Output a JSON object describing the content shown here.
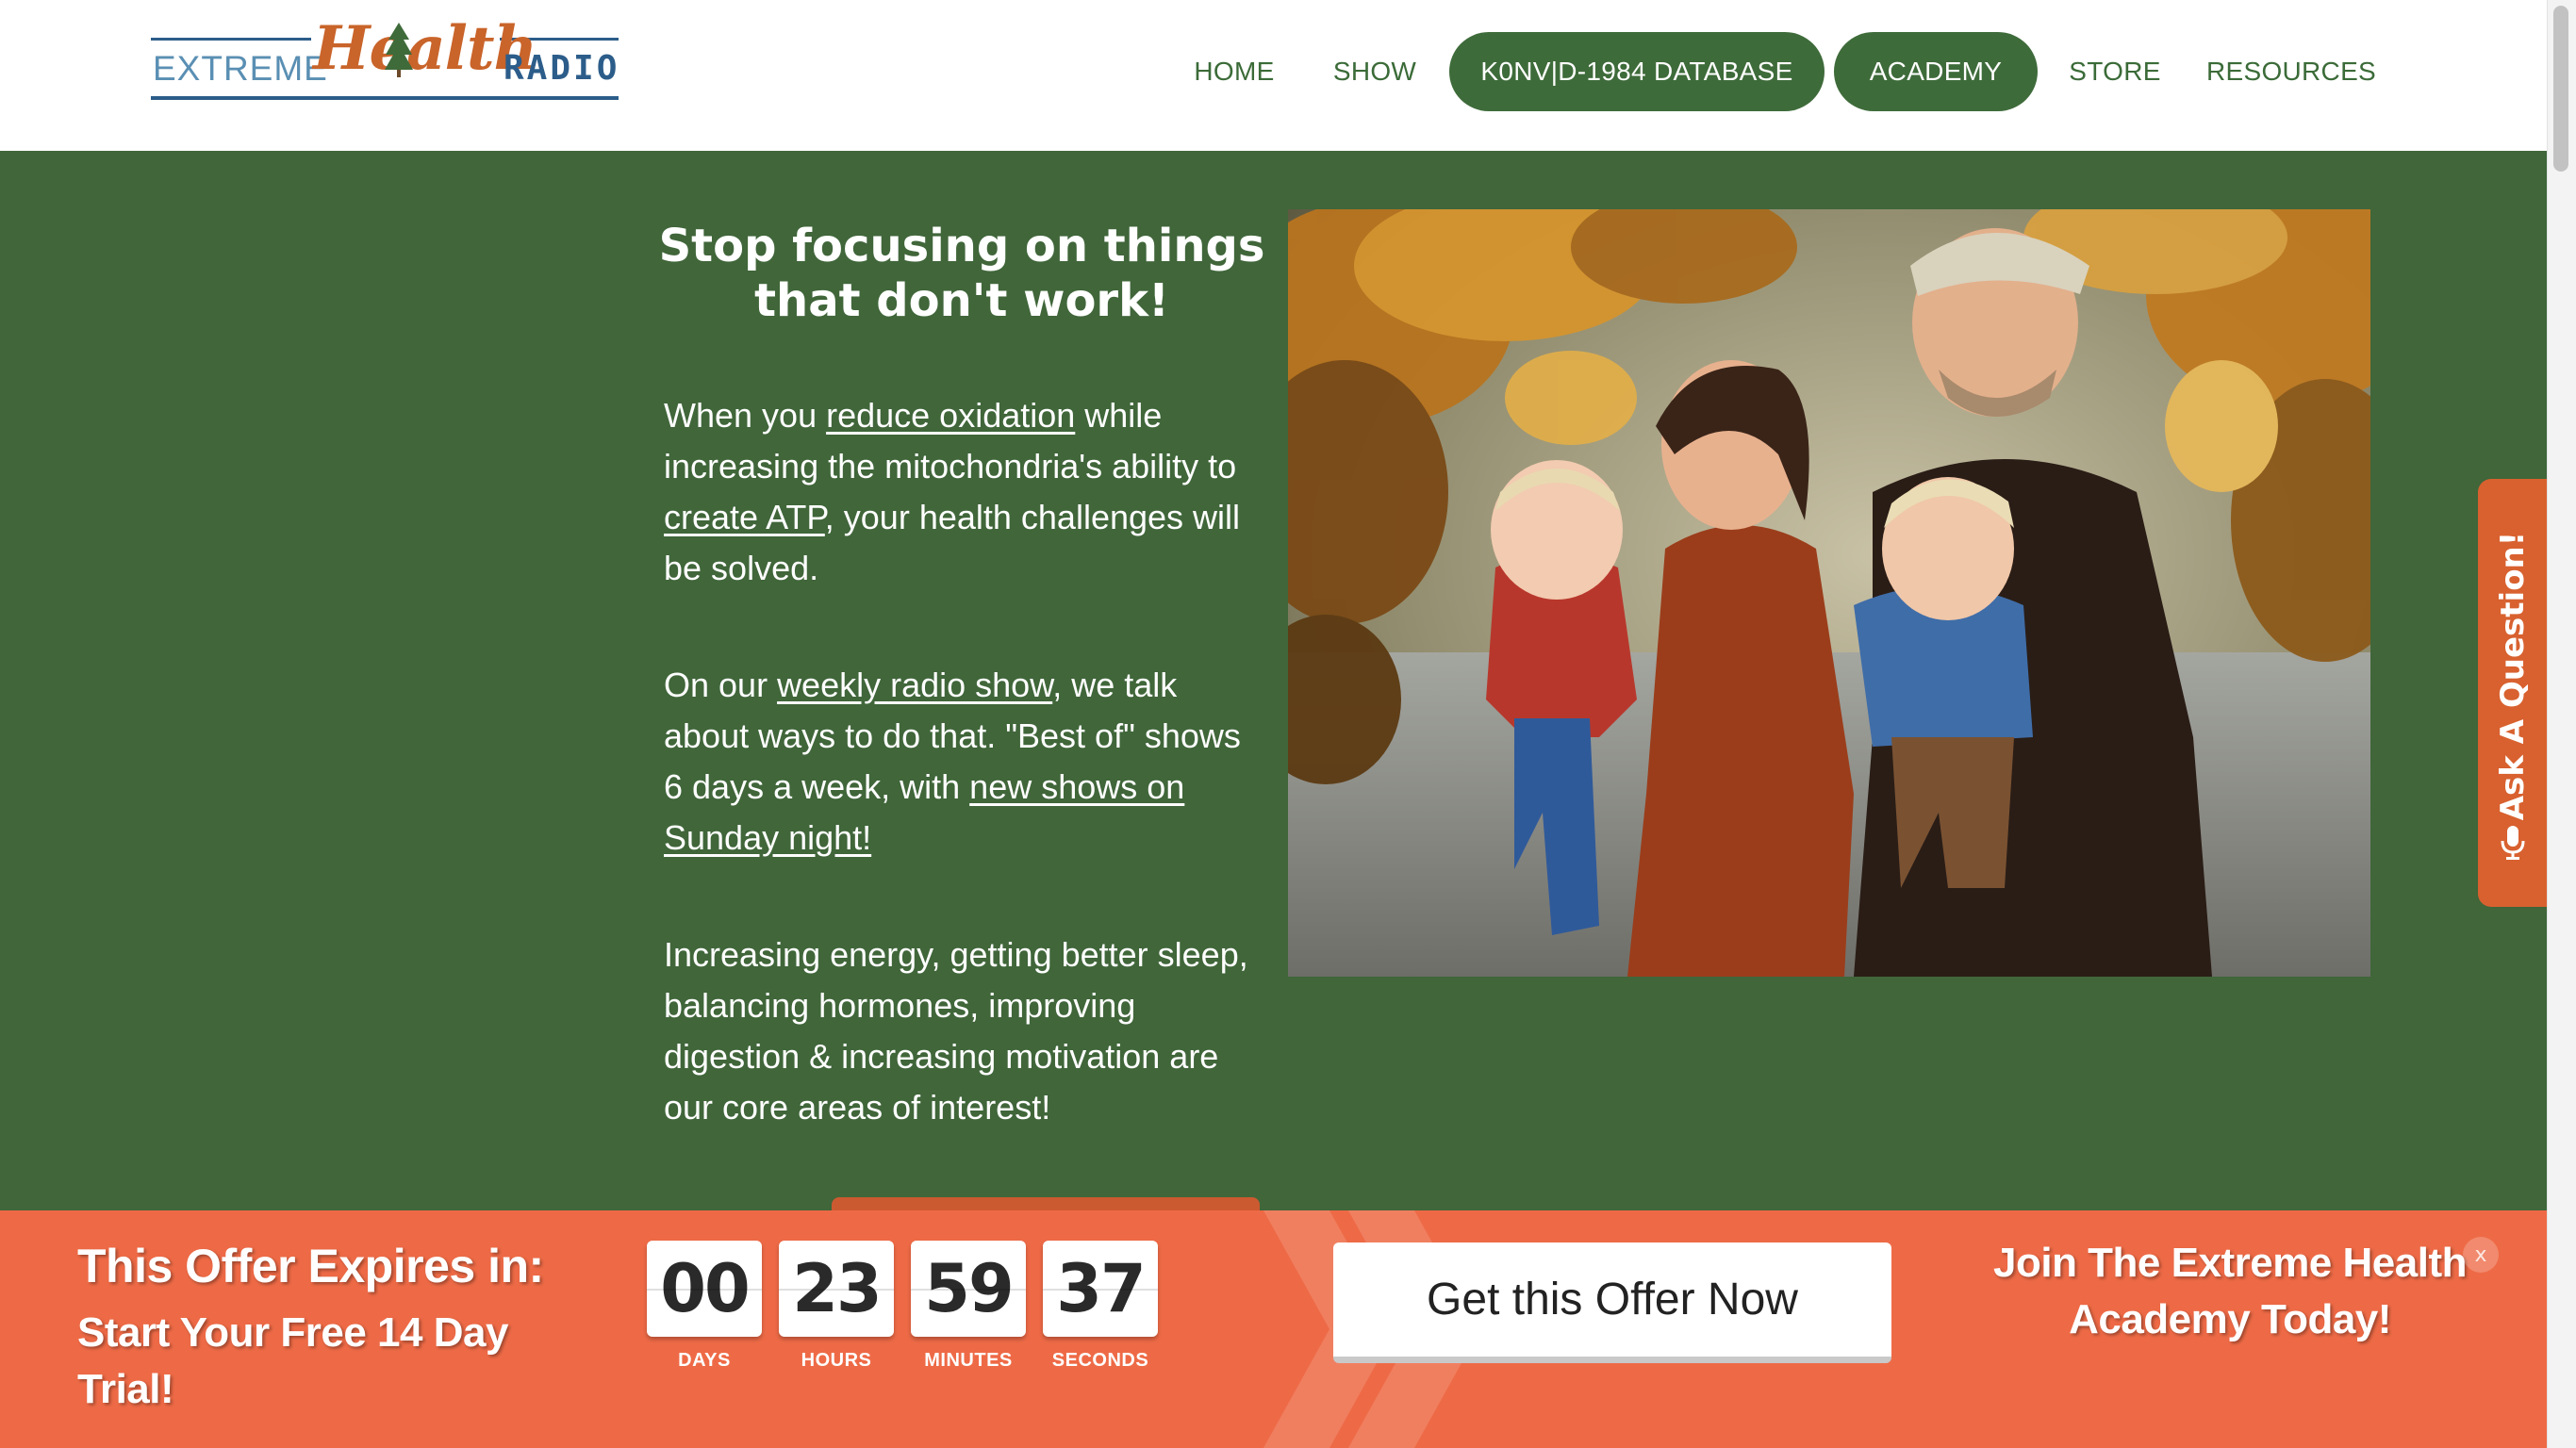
{
  "header": {
    "logo": {
      "word_left": "EXTREME",
      "word_main": "Health",
      "word_right": "RADIO"
    },
    "nav": [
      {
        "label": "HOME",
        "style": "link"
      },
      {
        "label": "SHOW",
        "style": "link"
      },
      {
        "label": "K0NV|D-1984 DATABASE",
        "style": "pill"
      },
      {
        "label": "ACADEMY",
        "style": "pill"
      },
      {
        "label": "STORE",
        "style": "link"
      },
      {
        "label": "RESOURCES",
        "style": "link"
      }
    ]
  },
  "hero": {
    "headline": "Stop focusing on things that don't work!",
    "para1": {
      "t1": "When you ",
      "link1": "reduce oxidation",
      "t2": " while increasing the mitochondria's ability to ",
      "link2": "create ATP",
      "t3": ", your health challenges will be solved."
    },
    "para2": {
      "t1": "On our ",
      "link1": "weekly radio show",
      "t2": ", we talk about ways to do that. \"Best of\" shows 6 days a week, with ",
      "link2": "new shows on Sunday night!"
    },
    "para3": "Increasing energy, getting better sleep, balancing hormones, improving digestion & increasing motivation are our core areas of interest!",
    "photo_icon": "family-photo"
  },
  "ask_tab": {
    "label": "Ask A Question!",
    "icon": "microphone-icon"
  },
  "offer": {
    "title": "This Offer Expires in:",
    "subtitle": "Start Your Free 14 Day Trial!",
    "countdown": [
      {
        "value": "00",
        "unit": "DAYS"
      },
      {
        "value": "23",
        "unit": "HOURS"
      },
      {
        "value": "59",
        "unit": "MINUTES"
      },
      {
        "value": "37",
        "unit": "SECONDS"
      }
    ],
    "button": "Get this Offer Now",
    "join_text": "Join  The Extreme Health Academy Today!",
    "close": "x"
  },
  "colors": {
    "brand_green": "#40663a",
    "offer_orange": "#ee6a46",
    "tab_orange": "#d8612f",
    "logo_blue": "#2c5d8a",
    "logo_orange": "#c9642a"
  }
}
